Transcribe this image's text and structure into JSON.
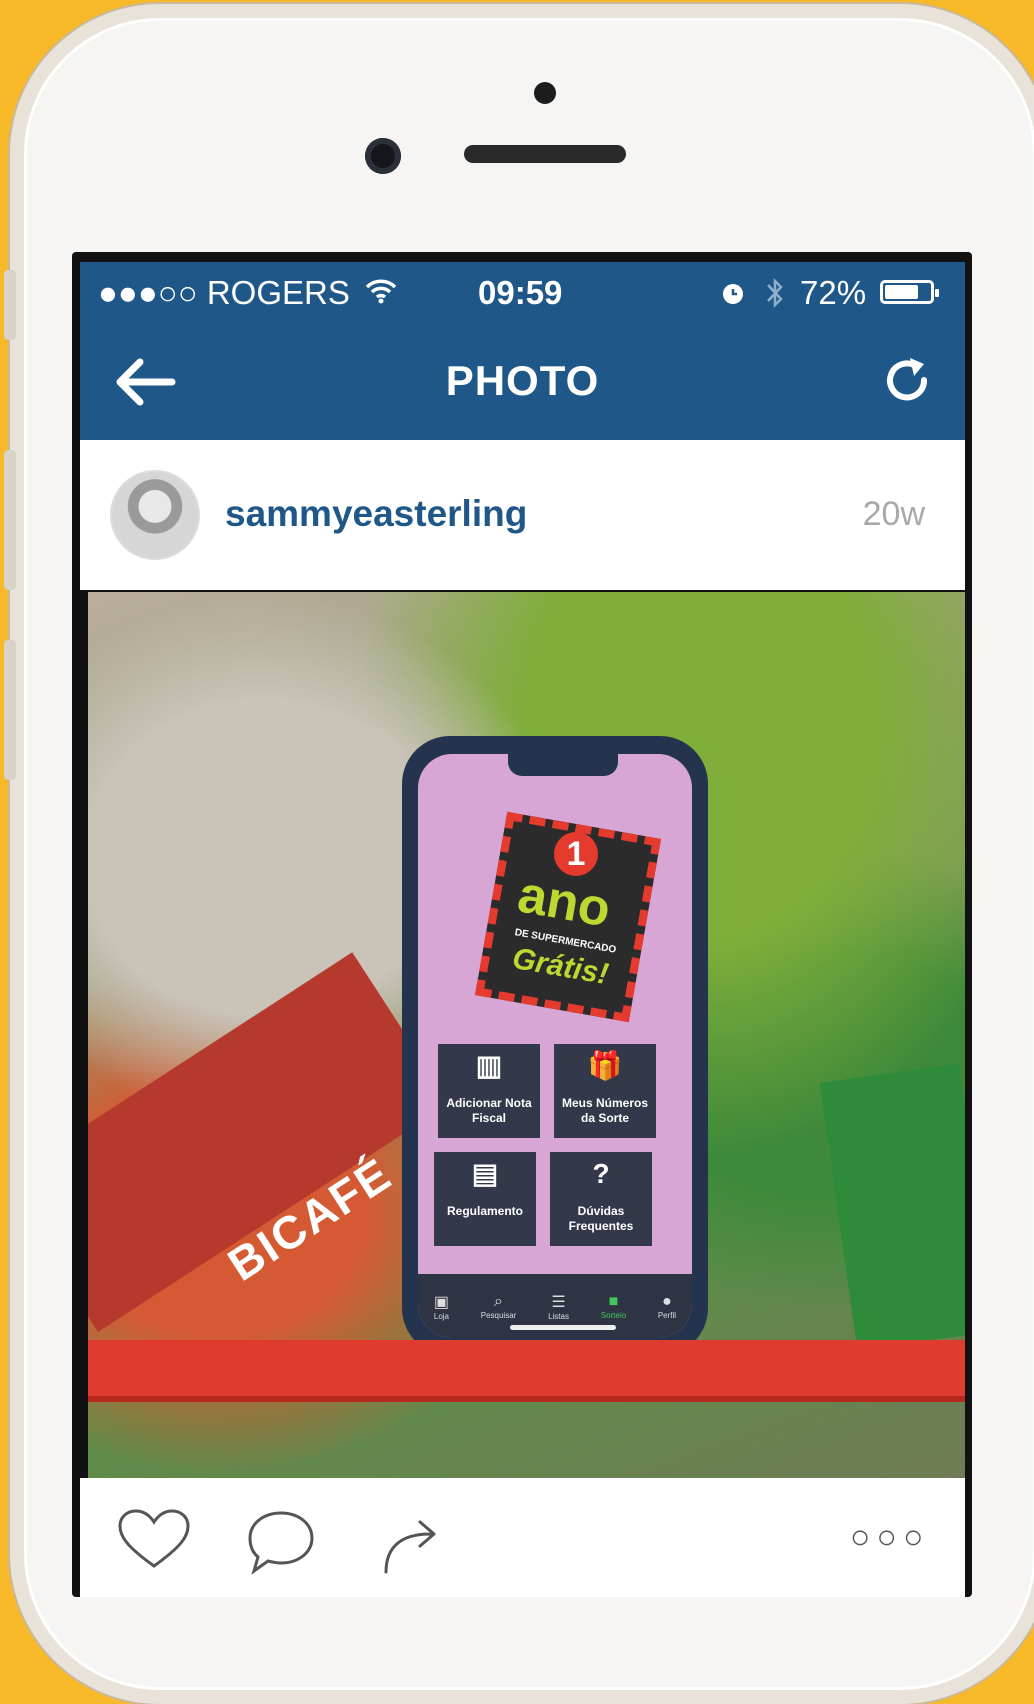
{
  "status_bar": {
    "carrier": "●●●○○ ROGERS",
    "time": "09:59",
    "battery": "72%",
    "battery_level": 0.72
  },
  "navbar": {
    "title": "PHOTO"
  },
  "post": {
    "username": "sammyeasterling",
    "age": "20w"
  },
  "photo_content": {
    "brand_box": "BICAFÉ",
    "promo_number": "1",
    "promo_title": "ano",
    "promo_subtitle": "DE SUPERMERCADO",
    "promo_free": "Grátis!",
    "tiles": [
      {
        "label": "Adicionar Nota Fiscal",
        "icon": "barcode-icon"
      },
      {
        "label": "Meus Números da Sorte",
        "icon": "gift-icon"
      },
      {
        "label": "Regulamento",
        "icon": "document-icon"
      },
      {
        "label": "Dúvidas Frequentes",
        "icon": "question-icon"
      }
    ],
    "tabs": [
      "Loja",
      "Pesquisar",
      "Listas",
      "Sorteio",
      "Perfil"
    ]
  },
  "actions": {
    "more": "○○○"
  },
  "colors": {
    "background": "#F7B928",
    "brand_blue": "#1E5788"
  }
}
